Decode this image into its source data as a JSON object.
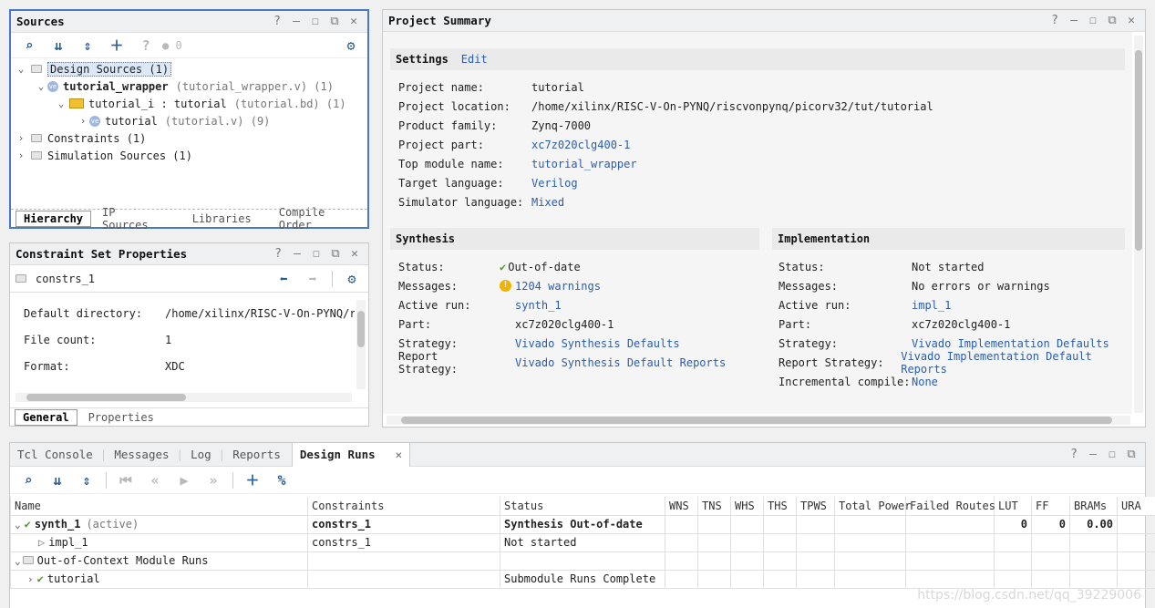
{
  "sources": {
    "title": "Sources",
    "badge_count": "0",
    "tree": {
      "design_sources": "Design Sources (1)",
      "wrapper_name": "tutorial_wrapper",
      "wrapper_file": "(tutorial_wrapper.v) (1)",
      "inst_name": "tutorial_i : tutorial",
      "inst_file": "(tutorial.bd) (1)",
      "tutorial_name": "tutorial",
      "tutorial_file": "(tutorial.v) (9)",
      "constraints": "Constraints (1)",
      "sim_sources": "Simulation Sources (1)"
    },
    "tabs": [
      "Hierarchy",
      "IP Sources",
      "Libraries",
      "Compile Order"
    ]
  },
  "csp": {
    "title": "Constraint Set Properties",
    "name": "constrs_1",
    "rows": [
      {
        "k": "Default directory:",
        "v": "/home/xilinx/RISC-V-On-PYNQ/riscvor"
      },
      {
        "k": "File count:",
        "v": "1"
      },
      {
        "k": "Format:",
        "v": "XDC"
      }
    ],
    "tabs": [
      "General",
      "Properties"
    ]
  },
  "summary": {
    "title": "Project Summary",
    "settings_label": "Settings",
    "edit_label": "Edit",
    "settings": [
      {
        "k": "Project name:",
        "v": "tutorial",
        "link": false
      },
      {
        "k": "Project location:",
        "v": "/home/xilinx/RISC-V-On-PYNQ/riscvonpynq/picorv32/tut/tutorial",
        "link": false
      },
      {
        "k": "Product family:",
        "v": "Zynq-7000",
        "link": false
      },
      {
        "k": "Project part:",
        "v": "xc7z020clg400-1",
        "link": true
      },
      {
        "k": "Top module name:",
        "v": "tutorial_wrapper",
        "link": true
      },
      {
        "k": "Target language:",
        "v": "Verilog",
        "link": true
      },
      {
        "k": "Simulator language:",
        "v": "Mixed",
        "link": true
      }
    ],
    "synthesis_label": "Synthesis",
    "synthesis": [
      {
        "k": "Status:",
        "v": "Out-of-date",
        "link": false,
        "icon": "check"
      },
      {
        "k": "Messages:",
        "v": "1204 warnings",
        "link": true,
        "icon": "warn"
      },
      {
        "k": "Active run:",
        "v": "synth_1",
        "link": true,
        "icon": ""
      },
      {
        "k": "Part:",
        "v": "xc7z020clg400-1",
        "link": false,
        "icon": ""
      },
      {
        "k": "Strategy:",
        "v": "Vivado Synthesis Defaults",
        "link": true,
        "icon": ""
      },
      {
        "k": "Report Strategy:",
        "v": "Vivado Synthesis Default Reports",
        "link": true,
        "icon": ""
      }
    ],
    "implementation_label": "Implementation",
    "implementation": [
      {
        "k": "Status:",
        "v": "Not started",
        "link": false
      },
      {
        "k": "Messages:",
        "v": "No errors or warnings",
        "link": false
      },
      {
        "k": "Active run:",
        "v": "impl_1",
        "link": true
      },
      {
        "k": "Part:",
        "v": "xc7z020clg400-1",
        "link": false
      },
      {
        "k": "Strategy:",
        "v": "Vivado Implementation Defaults",
        "link": true
      },
      {
        "k": "Report Strategy:",
        "v": "Vivado Implementation Default Reports",
        "link": true
      },
      {
        "k": "Incremental compile:",
        "v": "None",
        "link": true
      }
    ]
  },
  "bottom": {
    "tabs": [
      "Tcl Console",
      "Messages",
      "Log",
      "Reports",
      "Design Runs"
    ],
    "active_tab": "Design Runs",
    "columns": [
      "Name",
      "Constraints",
      "Status",
      "WNS",
      "TNS",
      "WHS",
      "THS",
      "TPWS",
      "Total Power",
      "Failed Routes",
      "LUT",
      "FF",
      "BRAMs",
      "URA"
    ],
    "rows": [
      {
        "name": "synth_1",
        "suffix": "(active)",
        "constraints": "constrs_1",
        "status": "Synthesis Out-of-date",
        "lut": "0",
        "ff": "0",
        "brams": "0.00"
      },
      {
        "name": "impl_1",
        "suffix": "",
        "constraints": "constrs_1",
        "status": "Not started",
        "lut": "",
        "ff": "",
        "brams": ""
      },
      {
        "name": "Out-of-Context Module Runs",
        "suffix": "",
        "constraints": "",
        "status": "",
        "lut": "",
        "ff": "",
        "brams": ""
      },
      {
        "name": "tutorial",
        "suffix": "",
        "constraints": "",
        "status": "Submodule Runs Complete",
        "lut": "",
        "ff": "",
        "brams": ""
      }
    ]
  },
  "watermark": "https://blog.csdn.net/qq_39229006",
  "colors": {
    "accent": "#4472c4",
    "link": "#2a5db0",
    "check": "#4a9a2a",
    "warn": "#f0b400"
  }
}
